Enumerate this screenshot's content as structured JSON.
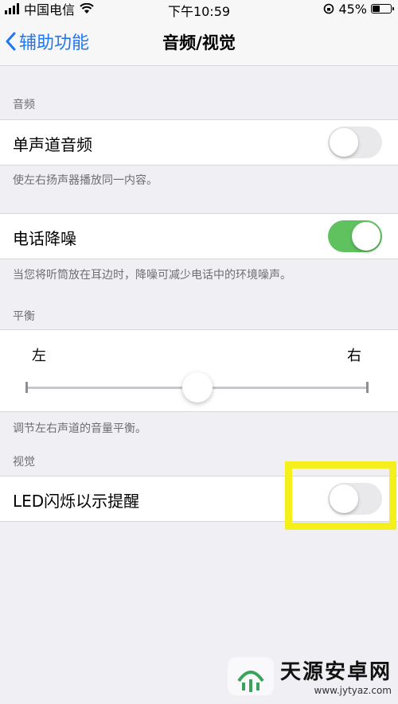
{
  "status_bar": {
    "carrier": "中国电信",
    "time": "下午10:59",
    "battery_percent": "45%",
    "battery_level": 0.45
  },
  "nav": {
    "back_label": "辅助功能",
    "title": "音频/视觉"
  },
  "sections": {
    "audio_header": "音频",
    "mono_label": "单声道音频",
    "mono_on": false,
    "mono_note": "使左右扬声器播放同一内容。",
    "noise_label": "电话降噪",
    "noise_on": true,
    "noise_note": "当您将听筒放在耳边时，降噪可减少电话中的环境噪声。",
    "balance_header": "平衡",
    "balance_left": "左",
    "balance_right": "右",
    "balance_value": 0.5,
    "balance_note": "调节左右声道的音量平衡。",
    "visual_header": "视觉",
    "led_label": "LED闪烁以示提醒",
    "led_on": false
  },
  "watermark": {
    "main": "天源安卓网",
    "sub": "www.jytyaz.com"
  },
  "colors": {
    "accent": "#1f77f3",
    "toggle_on": "#5fc25f",
    "highlight": "#f5ef1b"
  }
}
